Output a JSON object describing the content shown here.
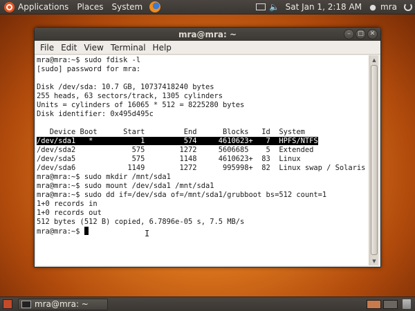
{
  "top_panel": {
    "applications": "Applications",
    "places": "Places",
    "system": "System",
    "clock": "Sat Jan  1,  2:18 AM",
    "user": "mra"
  },
  "window": {
    "title": "mra@mra: ~",
    "menu": [
      "File",
      "Edit",
      "View",
      "Terminal",
      "Help"
    ]
  },
  "terminal": {
    "lines": [
      "mra@mra:~$ sudo fdisk -l",
      "[sudo] password for mra:",
      "",
      "Disk /dev/sda: 10.7 GB, 10737418240 bytes",
      "255 heads, 63 sectors/track, 1305 cylinders",
      "Units = cylinders of 16065 * 512 = 8225280 bytes",
      "Disk identifier: 0x495d495c",
      "",
      "   Device Boot      Start         End      Blocks   Id  System",
      "/dev/sda1   *           1         574     4610623+   7  HPFS/NTFS",
      "/dev/sda2             575        1272     5606685    5  Extended",
      "/dev/sda5             575        1148     4610623+  83  Linux",
      "/dev/sda6            1149        1272      995998+  82  Linux swap / Solaris",
      "mra@mra:~$ sudo mkdir /mnt/sda1",
      "mra@mra:~$ sudo mount /dev/sda1 /mnt/sda1",
      "mra@mra:~$ sudo dd if=/dev/sda of=/mnt/sda1/grubboot bs=512 count=1",
      "1+0 records in",
      "1+0 records out",
      "512 bytes (512 B) copied, 6.7896e-05 s, 7.5 MB/s",
      "mra@mra:~$ "
    ]
  },
  "bottom_panel": {
    "task_label": "mra@mra: ~"
  }
}
